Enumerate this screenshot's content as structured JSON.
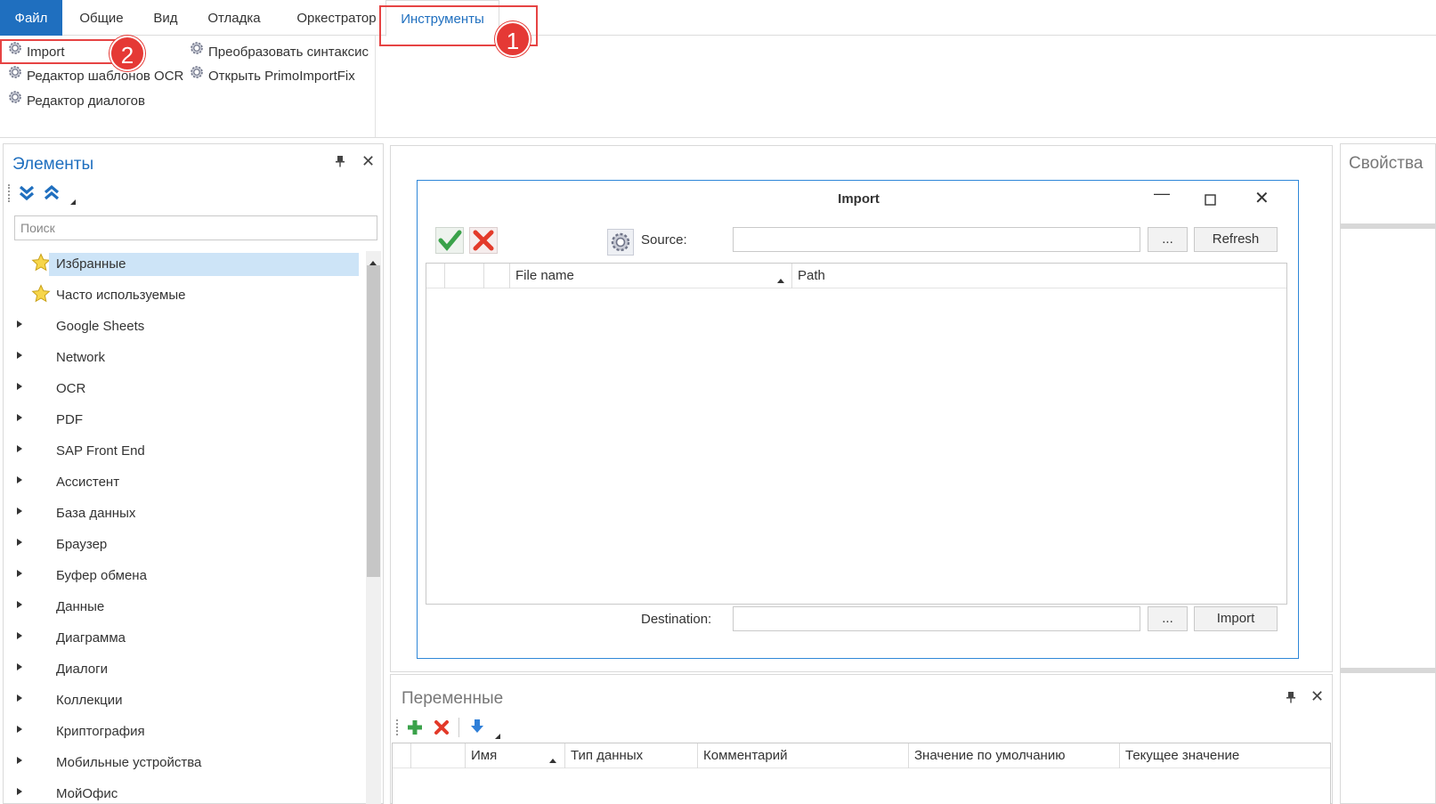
{
  "menu": {
    "file": "Файл",
    "general": "Общие",
    "view": "Вид",
    "debug": "Отладка",
    "orchestrator": "Оркестратор",
    "tools": "Инструменты"
  },
  "ribbon": {
    "import": "Import",
    "ocr_template_editor": "Редактор шаблонов OCR",
    "dialog_editor": "Редактор диалогов",
    "convert_syntax": "Преобразовать синтаксис",
    "open_primoimportfix": "Открыть PrimoImportFix"
  },
  "annotations": {
    "badge1": "1",
    "badge2": "2",
    "highlight_color": "#e64343"
  },
  "elements_panel": {
    "title": "Элементы",
    "search_placeholder": "Поиск",
    "items": [
      {
        "label": "Избранные",
        "icon": "star-icon"
      },
      {
        "label": "Часто используемые",
        "icon": "star-icon"
      },
      {
        "label": "Google Sheets"
      },
      {
        "label": "Network"
      },
      {
        "label": "OCR"
      },
      {
        "label": "PDF"
      },
      {
        "label": "SAP Front End"
      },
      {
        "label": "Ассистент"
      },
      {
        "label": "База данных"
      },
      {
        "label": "Браузер"
      },
      {
        "label": "Буфер обмена"
      },
      {
        "label": "Данные"
      },
      {
        "label": "Диаграмма"
      },
      {
        "label": "Диалоги"
      },
      {
        "label": "Коллекции"
      },
      {
        "label": "Криптография"
      },
      {
        "label": "Мобильные устройства"
      },
      {
        "label": "МойОфис"
      }
    ]
  },
  "import_dialog": {
    "title": "Import",
    "source_label": "Source:",
    "source_value": "",
    "browse_label": "...",
    "refresh_label": "Refresh",
    "columns": [
      "File name",
      "Path"
    ],
    "destination_label": "Destination:",
    "destination_value": "",
    "import_label": "Import"
  },
  "variables_panel": {
    "title": "Переменные",
    "columns": [
      "Имя",
      "Тип данных",
      "Комментарий",
      "Значение по умолчанию",
      "Текущее значение"
    ]
  },
  "properties_panel": {
    "title": "Свойства"
  },
  "colors": {
    "accent": "#1f6fbf",
    "selection": "#cde4f7",
    "dialog_border": "#2f87d8"
  }
}
